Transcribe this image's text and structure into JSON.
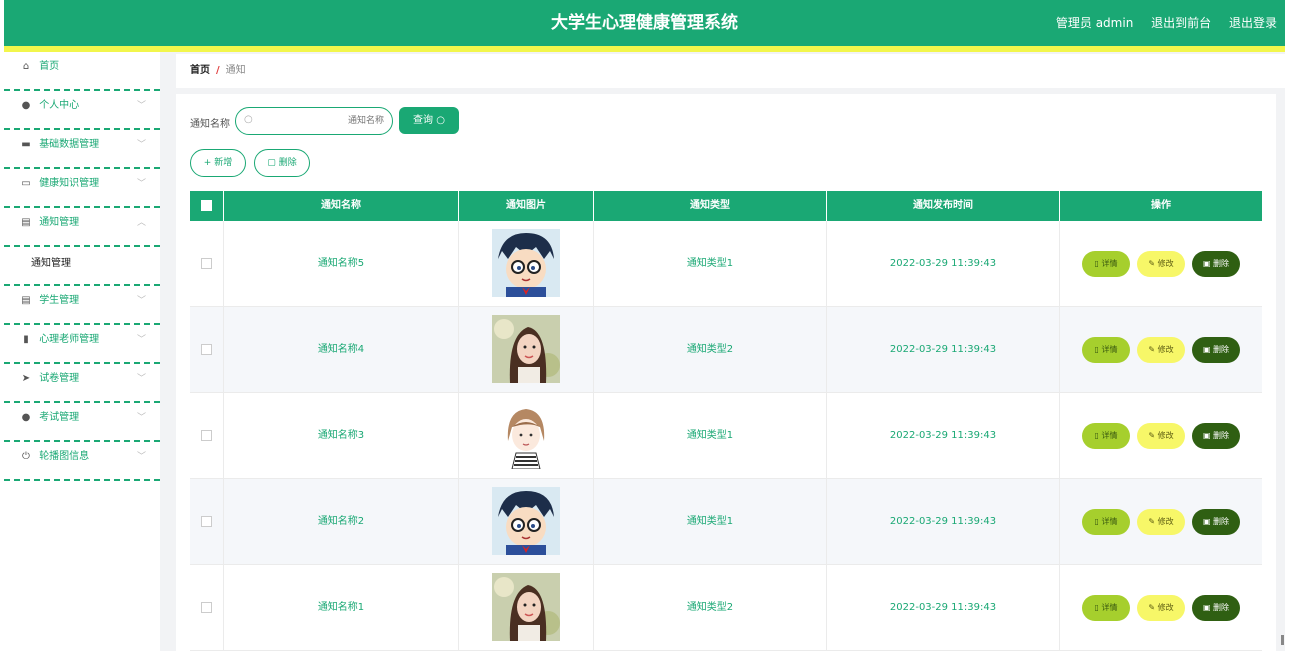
{
  "header": {
    "title": "大学生心理健康管理系统",
    "admin_label": "管理员 admin",
    "front_label": "退出到前台",
    "logout_label": "退出登录"
  },
  "sidebar": {
    "items": [
      {
        "label": "首页",
        "icon": "home-icon",
        "chevron": false
      },
      {
        "label": "个人中心",
        "icon": "user-icon",
        "chevron": true
      },
      {
        "label": "基础数据管理",
        "icon": "briefcase-icon",
        "chevron": true
      },
      {
        "label": "健康知识管理",
        "icon": "chat-icon",
        "chevron": true
      },
      {
        "label": "通知管理",
        "icon": "clipboard-icon",
        "chevron": true,
        "expanded": true
      }
    ],
    "sub_item": "通知管理",
    "items_after": [
      {
        "label": "学生管理",
        "icon": "clipboard-icon"
      },
      {
        "label": "心理老师管理",
        "icon": "bar-chart-icon"
      },
      {
        "label": "试卷管理",
        "icon": "send-icon"
      },
      {
        "label": "考试管理",
        "icon": "user-icon"
      },
      {
        "label": "轮播图信息",
        "icon": "power-icon"
      }
    ]
  },
  "breadcrumb": {
    "home": "首页",
    "separator": "/",
    "current": "通知"
  },
  "search": {
    "label": "通知名称",
    "placeholder": "通知名称",
    "button": "查询"
  },
  "actions": {
    "add": "新增",
    "delete": "删除"
  },
  "table": {
    "headers": [
      "通知名称",
      "通知图片",
      "通知类型",
      "通知发布时间",
      "操作"
    ],
    "rows": [
      {
        "name": "通知名称5",
        "image": "cartoon-boy-image",
        "type": "通知类型1",
        "time": "2022-03-29 11:39:43"
      },
      {
        "name": "通知名称4",
        "image": "girl-photo-image",
        "type": "通知类型2",
        "time": "2022-03-29 11:39:43"
      },
      {
        "name": "通知名称3",
        "image": "sketch-girl-image",
        "type": "通知类型1",
        "time": "2022-03-29 11:39:43"
      },
      {
        "name": "通知名称2",
        "image": "cartoon-boy-image",
        "type": "通知类型1",
        "time": "2022-03-29 11:39:43"
      },
      {
        "name": "通知名称1",
        "image": "girl-photo-image",
        "type": "通知类型2",
        "time": "2022-03-29 11:39:43"
      }
    ],
    "op_labels": {
      "detail": "详情",
      "edit": "修改",
      "delete": "删除"
    }
  },
  "colors": {
    "primary": "#1aa874",
    "accent_bar": "#f2f64c",
    "detail": "#a6cf2d",
    "edit": "#f7f768",
    "delete": "#2f5f12"
  }
}
